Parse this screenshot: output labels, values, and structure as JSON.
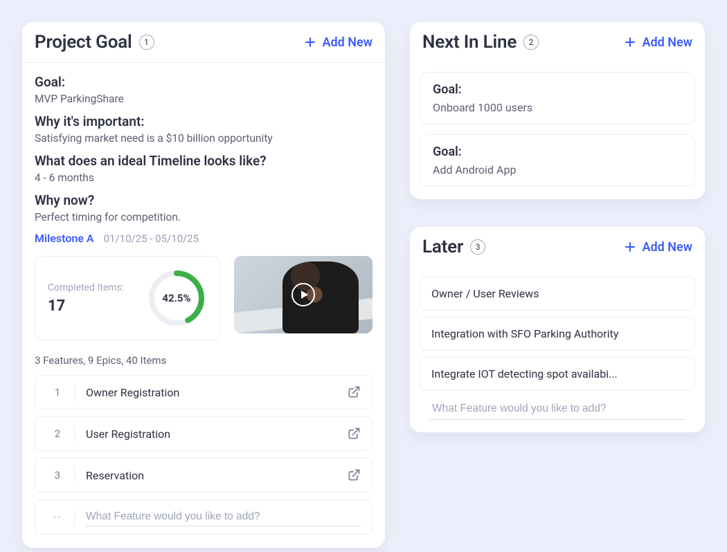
{
  "add_new_label": "Add New",
  "project_goal": {
    "title": "Project Goal",
    "badge": "1",
    "q1": "Goal:",
    "a1": "MVP ParkingShare",
    "q2": "Why it's important:",
    "a2": "Satisfying market need is a $10 billion opportunity",
    "q3": "What does an ideal Timeline looks like?",
    "a3": "4 - 6 months",
    "q4": "Why now?",
    "a4": "Perfect timing for competition.",
    "milestone_name": "Milestone A",
    "milestone_dates": "01/10/25 - 05/10/25",
    "completed_label": "Completed Items:",
    "completed_value": "17",
    "progress_pct": "42.5%",
    "progress_value": 42.5,
    "counts_text": "3 Features, 9 Epics, 40 Items",
    "features": [
      {
        "n": "1",
        "name": "Owner Registration"
      },
      {
        "n": "2",
        "name": "User Registration"
      },
      {
        "n": "3",
        "name": "Reservation"
      }
    ],
    "add_feature_placeholder": "What Feature would you like to add?",
    "add_feature_num": "--"
  },
  "next": {
    "title": "Next In Line",
    "badge": "2",
    "goals": [
      {
        "q": "Goal:",
        "a": "Onboard 1000 users"
      },
      {
        "q": "Goal:",
        "a": "Add Android App"
      }
    ]
  },
  "later": {
    "title": "Later",
    "badge": "3",
    "items": [
      "Owner / User Reviews",
      "Integration with SFO Parking Authority",
      "Integrate IOT detecting spot availabi..."
    ],
    "add_placeholder": "What Feature would you like to add?"
  }
}
